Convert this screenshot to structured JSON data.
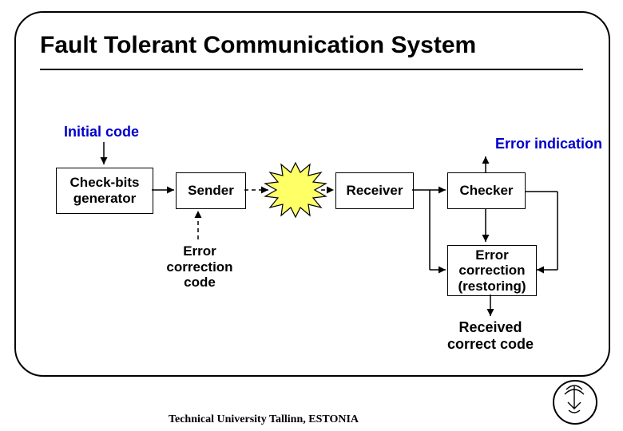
{
  "title": "Fault Tolerant Communication System",
  "labels": {
    "initial_code": "Initial code",
    "error_indication": "Error indication",
    "error_correction_code": "Error\ncorrection\ncode",
    "received_correct_code": "Received\ncorrect code"
  },
  "boxes": {
    "check_bits_generator": "Check-bits\ngenerator",
    "sender": "Sender",
    "receiver": "Receiver",
    "checker": "Checker",
    "error_correction_restoring": "Error\ncorrection\n(restoring)"
  },
  "footer": "Technical University Tallinn, ESTONIA"
}
